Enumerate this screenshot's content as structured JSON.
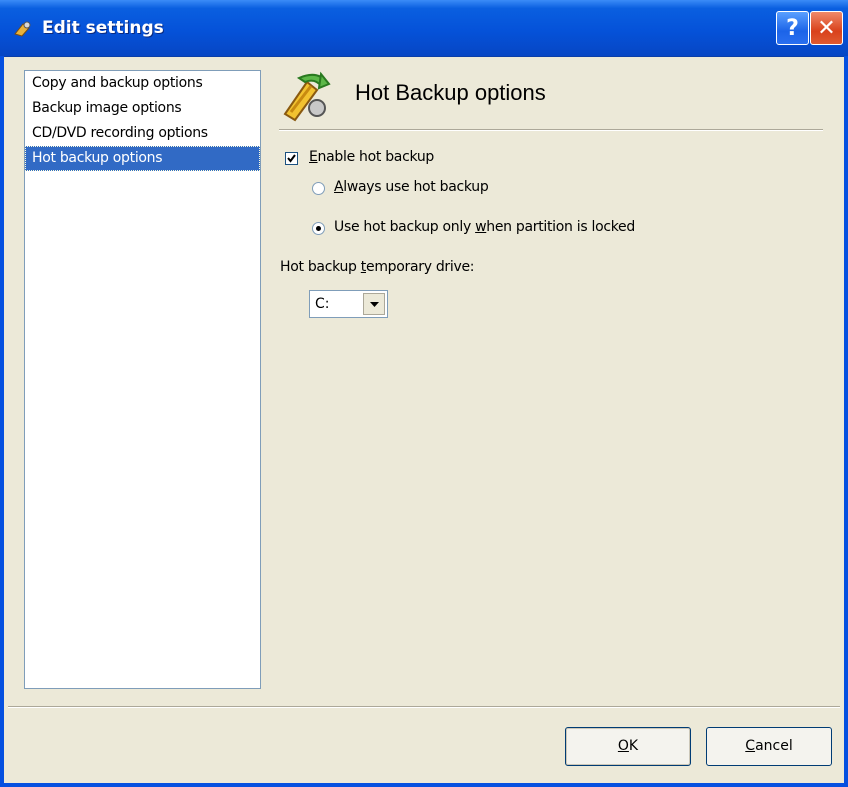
{
  "window": {
    "title": "Edit settings",
    "help_label": "?",
    "close_label": "✕"
  },
  "sidebar": {
    "items": [
      {
        "label": "Copy and backup options",
        "selected": false
      },
      {
        "label": "Backup image options",
        "selected": false
      },
      {
        "label": "CD/DVD recording options",
        "selected": false
      },
      {
        "label": "Hot backup options",
        "selected": true
      }
    ]
  },
  "panel": {
    "title": "Hot Backup options",
    "enable_hot_backup": {
      "prefix": "",
      "accel": "E",
      "rest": "nable hot backup",
      "checked": true
    },
    "always_use": {
      "prefix": "",
      "accel": "A",
      "rest": "lways use hot backup",
      "selected": false
    },
    "only_when_locked": {
      "prefix": "Use hot backup only ",
      "accel": "w",
      "rest": "hen partition is locked",
      "selected": true
    },
    "drive_label": {
      "prefix": "Hot backup ",
      "accel": "t",
      "rest": "emporary drive:"
    },
    "drive_value": "C:"
  },
  "footer": {
    "ok": {
      "accel": "O",
      "rest": "K"
    },
    "cancel": {
      "accel": "C",
      "rest": "ancel"
    }
  },
  "colors": {
    "titlebar": "#0552d9",
    "selection": "#316ac5",
    "dialog_bg": "#ece9d8"
  }
}
